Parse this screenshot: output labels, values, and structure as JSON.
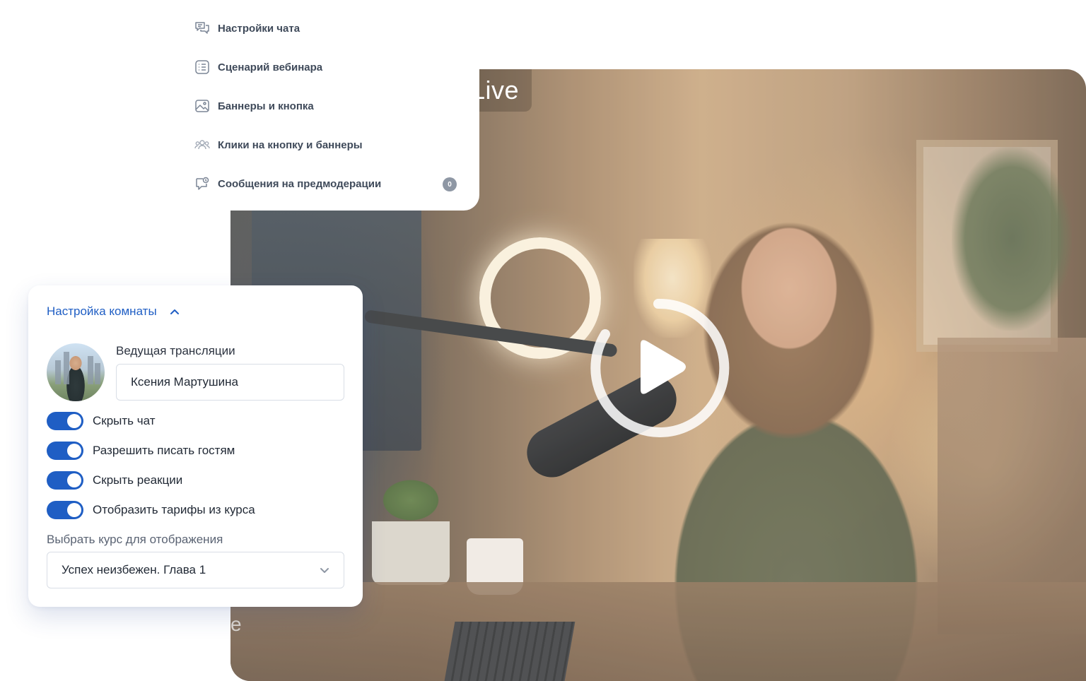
{
  "video": {
    "live_label": "Live",
    "faded_letter": "e"
  },
  "menu": {
    "items": [
      {
        "label": "Настройки чата",
        "icon": "chat-bubbles-icon"
      },
      {
        "label": "Сценарий вебинара",
        "icon": "list-icon"
      },
      {
        "label": "Баннеры и кнопка",
        "icon": "image-icon"
      },
      {
        "label": "Клики на кнопку и баннеры",
        "icon": "users-icon"
      },
      {
        "label": "Сообщения на предмодерации",
        "icon": "moderation-chat-icon"
      }
    ],
    "moderation_count": "0"
  },
  "room": {
    "title": "Настройка комнаты",
    "host_label": "Ведущая трансляции",
    "host_name": "Ксения Мартушина",
    "toggles": [
      {
        "label": "Скрыть чат",
        "on": true
      },
      {
        "label": "Разрешить писать гостям",
        "on": true
      },
      {
        "label": "Скрыть реакции",
        "on": true
      },
      {
        "label": "Отобразить тарифы из курса",
        "on": true
      }
    ],
    "course_label": "Выбрать курс для отображения",
    "course_value": "Успех неизбежен. Глава 1"
  },
  "colors": {
    "accent": "#1f5ec4",
    "menu_text": "#3f4a5a",
    "badge": "#8e97a4"
  }
}
